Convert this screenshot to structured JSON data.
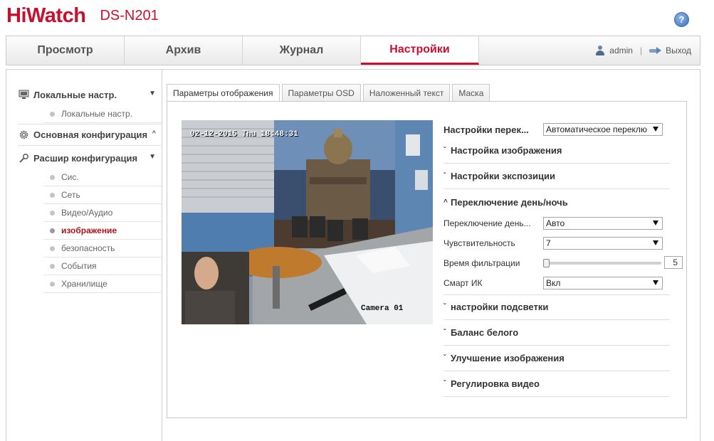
{
  "brand": {
    "logo_hi": "Hi",
    "logo_watch": "Watch",
    "model": "DS-N201"
  },
  "header": {
    "help_glyph": "?"
  },
  "nav": {
    "tabs": [
      {
        "label": "Просмотр"
      },
      {
        "label": "Архив"
      },
      {
        "label": "Журнал"
      },
      {
        "label": "Настройки",
        "active": true
      }
    ],
    "user": "admin",
    "separator": "|",
    "logout": "Выход"
  },
  "sidebar": {
    "groups": [
      {
        "label": "Локальные настр.",
        "icon": "monitor-icon",
        "expanded": true,
        "items": [
          {
            "label": "Локальные настр."
          }
        ]
      },
      {
        "label": "Основная конфигурация",
        "icon": "gear-icon",
        "expanded": false
      },
      {
        "label": "Расшир конфигурация",
        "icon": "wrench-icon",
        "expanded": true,
        "items": [
          {
            "label": "Сис."
          },
          {
            "label": "Сеть"
          },
          {
            "label": "Видео/Аудио"
          },
          {
            "label": "изображение",
            "active": true
          },
          {
            "label": "безопасность"
          },
          {
            "label": "События"
          },
          {
            "label": "Хранилище"
          }
        ]
      }
    ]
  },
  "tabs": [
    {
      "label": "Параметры отображения",
      "active": true
    },
    {
      "label": "Параметры OSD"
    },
    {
      "label": "Наложенный текст"
    },
    {
      "label": "Маска"
    }
  ],
  "video": {
    "osd_time": "02-12-2015 Thu 18:48:31",
    "osd_name": "Camera 01"
  },
  "settings": {
    "scene_switch": {
      "label": "Настройки перек...",
      "value": "Автоматическое переклю"
    },
    "sections_top": [
      {
        "label": "Настройка изображения",
        "expanded": false
      },
      {
        "label": "Настройки экспозиции",
        "expanded": false
      },
      {
        "label": "Переключение день/ночь",
        "expanded": true
      }
    ],
    "daynight": {
      "switch": {
        "label": "Переключение день...",
        "value": "Авто"
      },
      "sensitivity": {
        "label": "Чувствительность",
        "value": "7"
      },
      "filter_time": {
        "label": "Время фильтрации",
        "value": "5",
        "fraction": 0
      },
      "smart_ir": {
        "label": "Смарт ИК",
        "value": "Вкл"
      }
    },
    "sections_bottom": [
      {
        "label": "настройки подсветки"
      },
      {
        "label": "Баланс белого"
      },
      {
        "label": "Улучшение изображения"
      },
      {
        "label": "Регулировка видео"
      }
    ]
  },
  "colors": {
    "brand_red": "#c8102e",
    "active_item": "#b0151f"
  }
}
